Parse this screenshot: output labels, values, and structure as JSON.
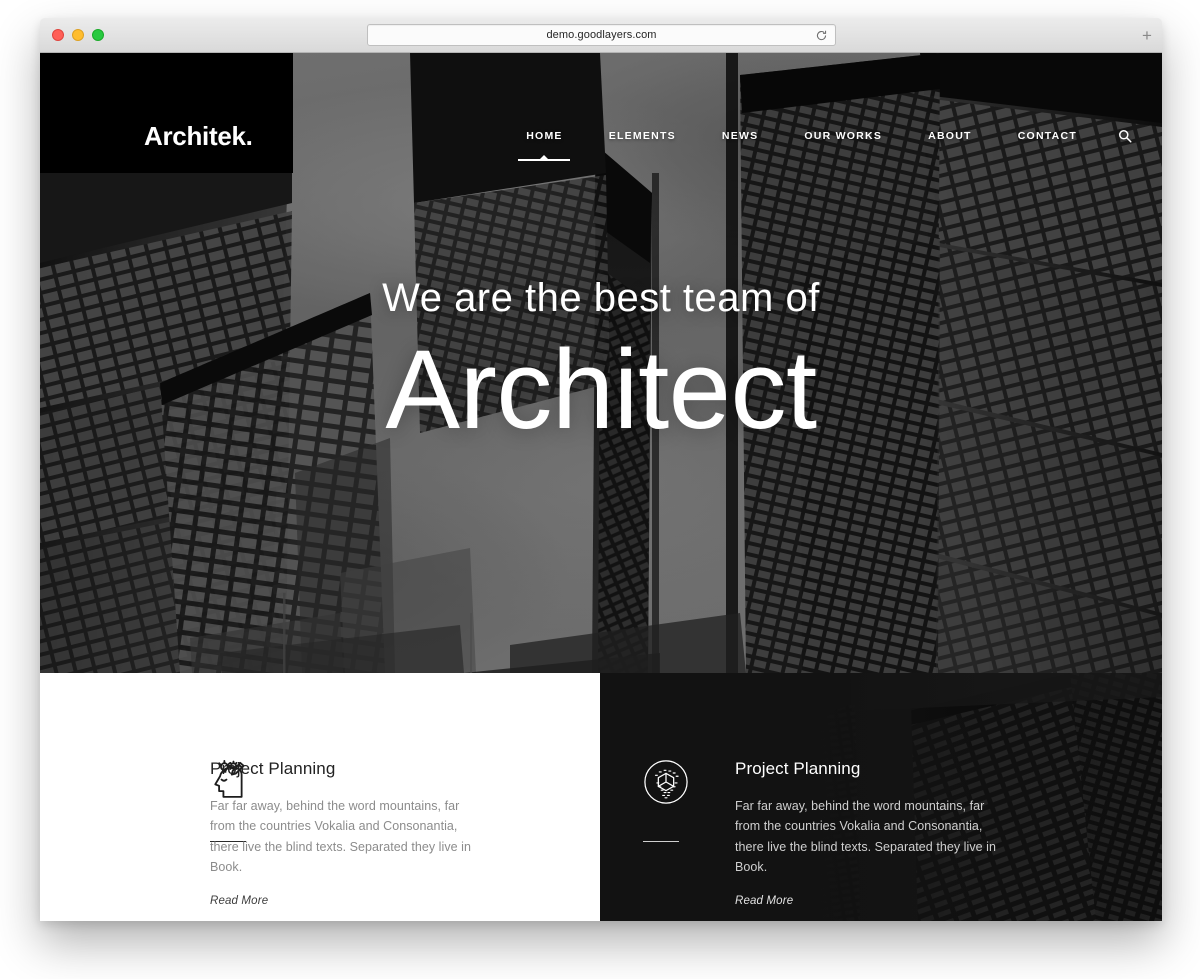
{
  "browser": {
    "url": "demo.goodlayers.com",
    "reload_icon": "reload-icon",
    "newtab_label": "+",
    "traffic_lights": [
      "close",
      "minimize",
      "maximize"
    ]
  },
  "site": {
    "logo": "Architek.",
    "nav": [
      {
        "label": "HOME",
        "active": true
      },
      {
        "label": "ELEMENTS",
        "active": false
      },
      {
        "label": "NEWS",
        "active": false
      },
      {
        "label": "OUR WORKS",
        "active": false
      },
      {
        "label": "ABOUT",
        "active": false
      },
      {
        "label": "CONTACT",
        "active": false
      }
    ],
    "search_icon": "search-icon",
    "hero": {
      "subtitle": "We are the best team of",
      "title": "Architect"
    },
    "features": [
      {
        "icon": "head-idea-icon",
        "title": "Project Planning",
        "text": "Far far away, behind the word mountains, far from the countries Vokalia and Consonantia, there live the blind texts. Separated they live in Book.",
        "link": "Read More",
        "theme": "light"
      },
      {
        "icon": "cube-circle-icon",
        "title": "Project Planning",
        "text": "Far far away, behind the word mountains, far from the countries Vokalia and Consonantia, there live the blind texts. Separated they live in Book.",
        "link": "Read More",
        "theme": "dark"
      }
    ]
  },
  "colors": {
    "logo_block": "#000000",
    "dark_panel": "#121212",
    "light_panel": "#ffffff",
    "text_muted": "#8c8c8c",
    "accent_white": "#ffffff"
  }
}
